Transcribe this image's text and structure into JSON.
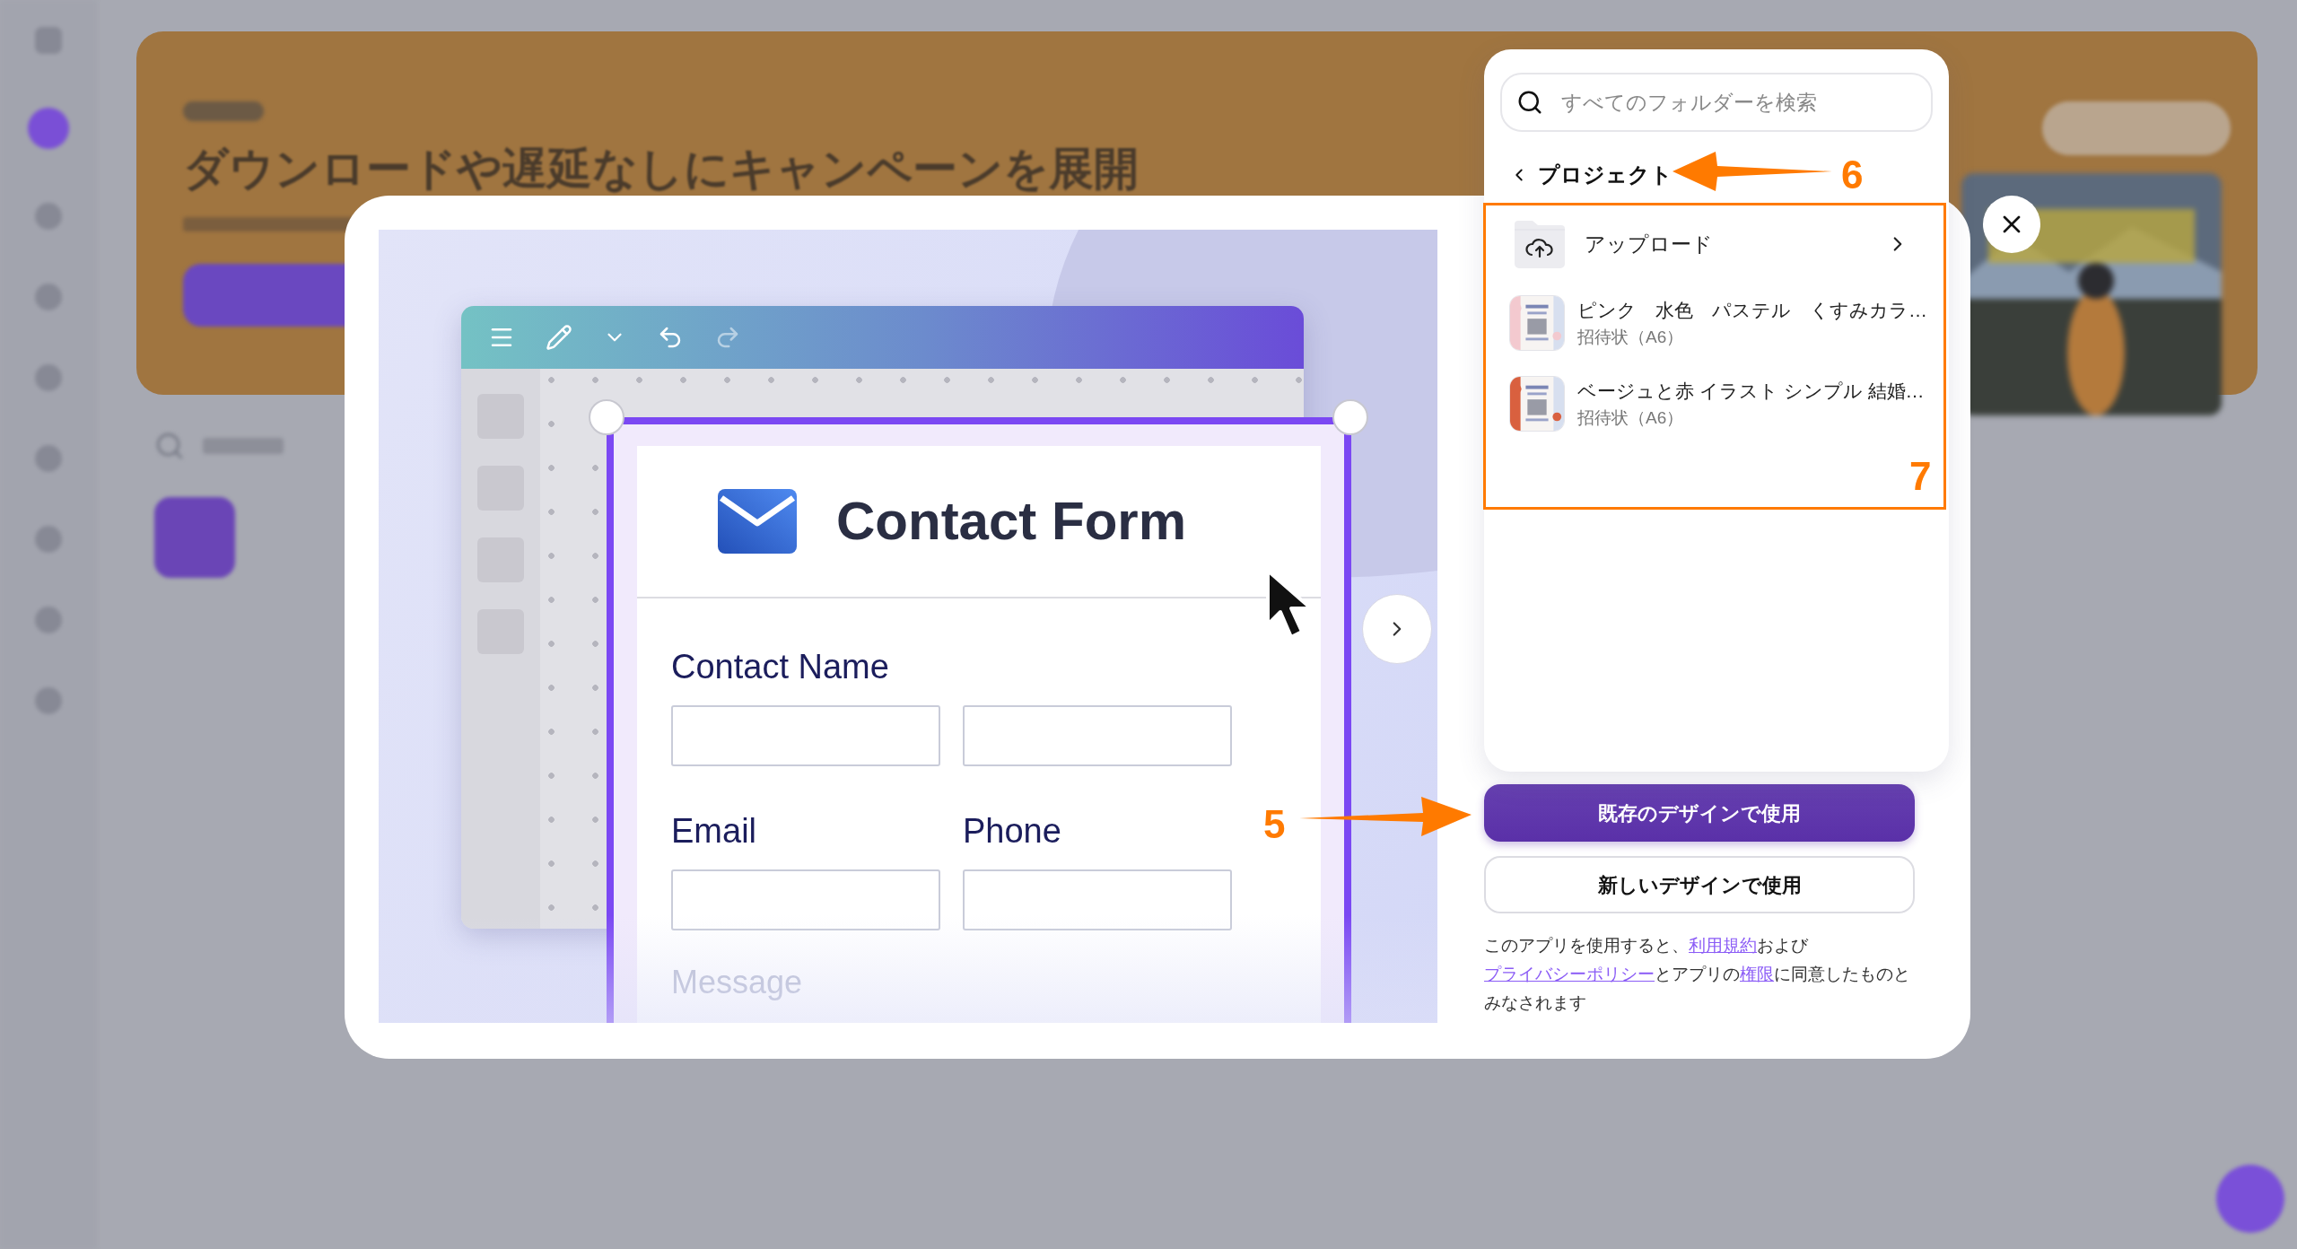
{
  "background": {
    "headline": "ダウンロードや遅延なしにキャンペーンを展開"
  },
  "preview": {
    "title": "Contact Form",
    "rows": [
      {
        "kind": "split",
        "labels": [
          "Contact Name"
        ]
      },
      {
        "kind": "pair",
        "labels": [
          "Email",
          "Phone"
        ]
      }
    ],
    "message_label": "Message"
  },
  "folder_panel": {
    "search": {
      "placeholder": "すべてのフォルダーを検索"
    },
    "breadcrumb": "プロジェクト",
    "items": [
      {
        "kind": "folder",
        "name": "アップロード"
      },
      {
        "kind": "design",
        "name": "ピンク　水色　パステル　くすみカラ…",
        "type": "招待状（A6）",
        "color": "#f3c9cf"
      },
      {
        "kind": "design",
        "name": "ベージュと赤 イラスト シンプル 結婚…",
        "type": "招待状（A6）",
        "color": "#d9603f"
      }
    ]
  },
  "buttons": [
    {
      "label": "既存のデザインで使用",
      "kind": "primary"
    },
    {
      "label": "新しいデザインで使用",
      "kind": "secondary"
    }
  ],
  "legal": [
    {
      "text": "このアプリを使用すると、"
    },
    {
      "text": "利用規約",
      "kind": "link"
    },
    {
      "text": "および"
    },
    {
      "text": "プライバシーポリシー",
      "kind": "link"
    },
    {
      "text": "とアプリの"
    },
    {
      "text": "権限",
      "kind": "link"
    },
    {
      "text": "に同意したものとみなされます"
    }
  ],
  "annotations": [
    {
      "label": "6",
      "kind": "arrow-left"
    },
    {
      "label": "7",
      "kind": "frame"
    },
    {
      "label": "5",
      "kind": "arrow-right"
    }
  ]
}
